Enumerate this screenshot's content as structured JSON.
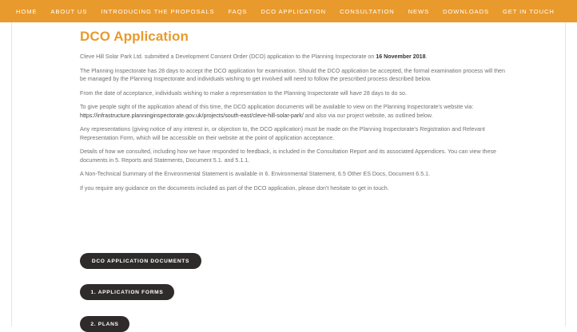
{
  "nav": {
    "items": [
      {
        "label": "HOME"
      },
      {
        "label": "ABOUT US"
      },
      {
        "label": "INTRODUCING THE PROPOSALS"
      },
      {
        "label": "FAQS"
      },
      {
        "label": "DCO APPLICATION"
      },
      {
        "label": "CONSULTATION"
      },
      {
        "label": "NEWS"
      },
      {
        "label": "DOWNLOADS"
      },
      {
        "label": "GET IN TOUCH"
      }
    ],
    "accent_color": "#e89a2c"
  },
  "main": {
    "title": "DCO Application",
    "p1_start": "Cleve Hill Solar Park Ltd. submitted a Development Consent Order (DCO) application to the Planning Inspectorate on ",
    "p1_date": "16 November 2018",
    "p1_end": ".",
    "p2": "The Planning Inspectorate has 28 days to accept the DCO application for examination. Should the DCO application be accepted, the formal examination process will then be managed by the Planning Inspectorate and individuals wishing to get involved will need to follow the prescribed process described below.",
    "p3": "From the date of acceptance, individuals wishing to make a representation to the Planning Inspectorate will have 28 days to do so.",
    "p4_start": "To give people sight of the application ahead of this time, the DCO application documents will be available to view on the Planning Inspectorate's website via: ",
    "p4_link": "https://infrastructure.planninginspectorate.gov.uk/projects/south-east/cleve-hill-solar-park/",
    "p4_end": " and also via our project website, as outlined below.",
    "p5": "Any representations (giving notice of any interest in, or objection to, the DCO application) must be made on the Planning Inspectorate's Registration and Relevant Representation Form, which will be accessible on their website at the point of application acceptance.",
    "p6": "Details of how we consulted, including how we have responded to feedback, is included in the Consultation Report and its associated Appendices. You can view these documents in 5. Reports and Statements, Document 5.1. and 5.1.1.",
    "p7": "A Non-Technical Summary of the Environmental Statement is available in 6. Environmental Statement, 6.5 Other ES Docs, Document 6.5.1.",
    "p8": "If you require any guidance on the documents included as part of the DCO application, please don't hesitate to get in touch."
  },
  "buttons": {
    "dco_docs": "DCO APPLICATION DOCUMENTS",
    "application_forms": "1. APPLICATION FORMS",
    "plans": "2. PLANS"
  }
}
